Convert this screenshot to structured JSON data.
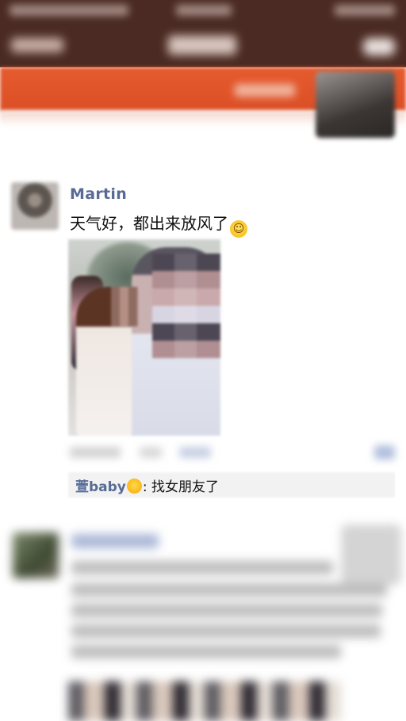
{
  "post": {
    "author": "Martin",
    "text": "天气好，都出来放风了",
    "emoji_name": "grin-emoji"
  },
  "comment": {
    "author": "萱baby",
    "separator": ": ",
    "text": "找女朋友了",
    "emoji_name": "smile-emoji"
  },
  "colors": {
    "header": "#4a2a22",
    "cover": "#e65b2f",
    "link_name": "#576b95"
  }
}
